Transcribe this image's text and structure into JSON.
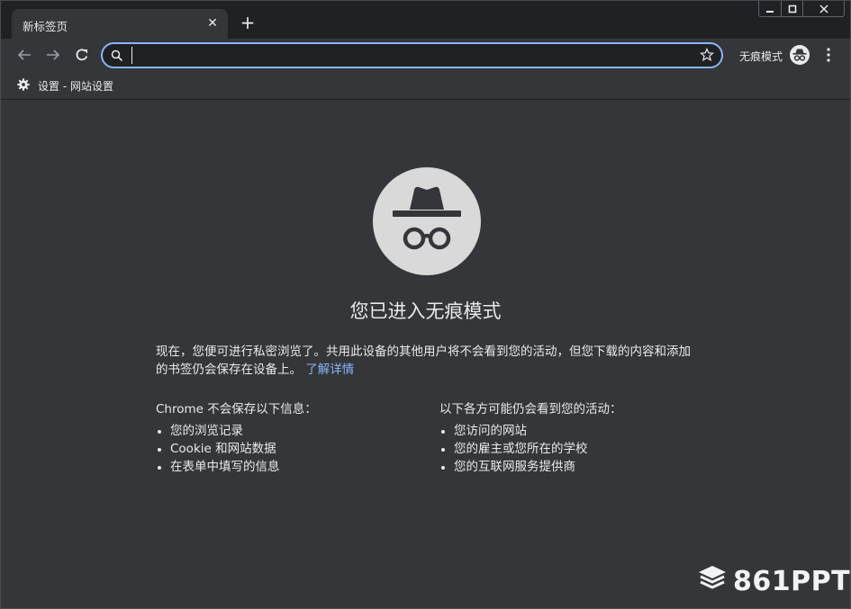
{
  "tab": {
    "title": "新标签页",
    "close_glyph": "✕"
  },
  "new_tab_glyph": "+",
  "window_controls": {
    "minimize_icon": "minimize-icon",
    "maximize_icon": "maximize-icon",
    "close_icon": "close-icon"
  },
  "toolbar": {
    "omnibox_value": "",
    "incognito_label": "无痕模式"
  },
  "bookmarks": [
    {
      "label": "设置 - 网站设置",
      "icon": "gear-icon"
    }
  ],
  "content": {
    "heading": "您已进入无痕模式",
    "paragraph": "现在，您便可进行私密浏览了。共用此设备的其他用户将不会看到您的活动，但您下载的内容和添加的书签仍会保存在设备上。",
    "learn_more": "了解详情",
    "left_title": "Chrome 不会保存以下信息：",
    "left_items": [
      "您的浏览记录",
      "Cookie 和网站数据",
      "在表单中填写的信息"
    ],
    "right_title": "以下各方可能仍会看到您的活动：",
    "right_items": [
      "您访问的网站",
      "您的雇主或您所在的学校",
      "您的互联网服务提供商"
    ]
  },
  "watermark": "861PPT",
  "colors": {
    "accent": "#8ab4f8",
    "background": "#35363a",
    "tabstrip": "#202124"
  }
}
